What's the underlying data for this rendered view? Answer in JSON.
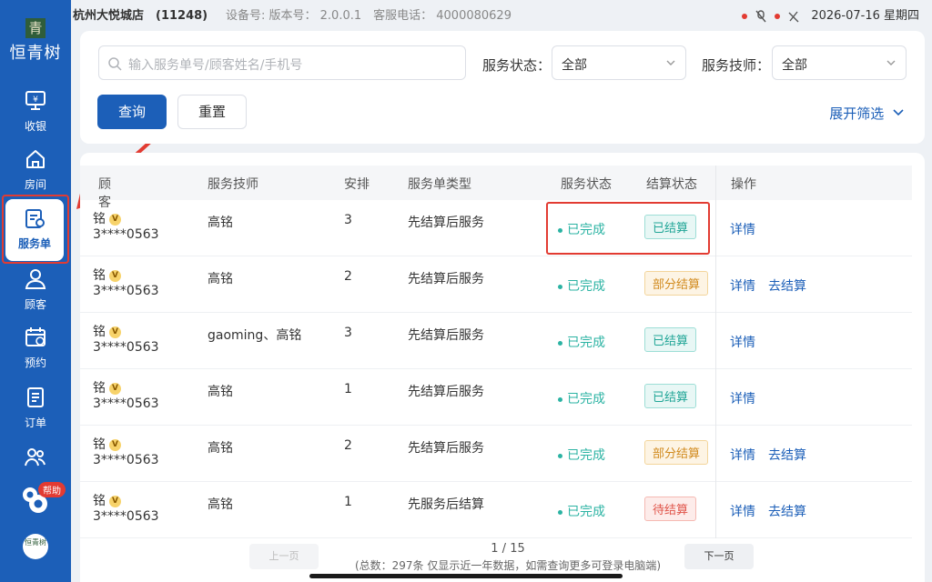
{
  "brand": {
    "logo_char": "青",
    "name": "恒青树",
    "bottom_logo_text": "恒青树"
  },
  "statusbar": {
    "store": "杭州大悦城店　(11248)",
    "meta": "设备号: 版本号： 2.0.0.1　客服电话： 4000080629",
    "datetime": "2026-07-16 星期四"
  },
  "sidebar": {
    "items": [
      {
        "label": "收银",
        "icon": "cashier-icon"
      },
      {
        "label": "房间",
        "icon": "home-icon"
      },
      {
        "label": "服务单",
        "icon": "service-order-icon",
        "active": true
      },
      {
        "label": "顾客",
        "icon": "customer-icon"
      },
      {
        "label": "预约",
        "icon": "calendar-icon"
      },
      {
        "label": "订单",
        "icon": "order-icon"
      },
      {
        "label": "",
        "icon": "staff-icon"
      }
    ],
    "help_label": "帮助"
  },
  "filters": {
    "search_placeholder": "输入服务单号/顾客姓名/手机号",
    "service_status_label": "服务状态：",
    "service_status_value": "全部",
    "technician_label": "服务技师：",
    "technician_value": "全部",
    "query_button": "查询",
    "reset_button": "重置",
    "expand_label": "展开筛选"
  },
  "table": {
    "headers": [
      "顾客",
      "服务技师",
      "安排",
      "服务单类型",
      "服务状态",
      "结算状态",
      "操作"
    ],
    "rows": [
      {
        "name": "铭",
        "phone": "3****0563",
        "tech": "高铭",
        "arrange": "3",
        "type": "先结算后服务",
        "status": "已完成",
        "settle": "已结算",
        "settle_kind": "done",
        "ops": [
          "详情"
        ]
      },
      {
        "name": "铭",
        "phone": "3****0563",
        "tech": "高铭",
        "arrange": "2",
        "type": "先结算后服务",
        "status": "已完成",
        "settle": "部分结算",
        "settle_kind": "partial",
        "ops": [
          "详情",
          "去结算"
        ]
      },
      {
        "name": "铭",
        "phone": "3****0563",
        "tech": "gaoming、高铭",
        "arrange": "3",
        "type": "先结算后服务",
        "status": "已完成",
        "settle": "已结算",
        "settle_kind": "done",
        "ops": [
          "详情"
        ]
      },
      {
        "name": "铭",
        "phone": "3****0563",
        "tech": "高铭",
        "arrange": "1",
        "type": "先结算后服务",
        "status": "已完成",
        "settle": "已结算",
        "settle_kind": "done",
        "ops": [
          "详情"
        ]
      },
      {
        "name": "铭",
        "phone": "3****0563",
        "tech": "高铭",
        "arrange": "2",
        "type": "先结算后服务",
        "status": "已完成",
        "settle": "部分结算",
        "settle_kind": "partial",
        "ops": [
          "详情",
          "去结算"
        ]
      },
      {
        "name": "铭",
        "phone": "3****0563",
        "tech": "高铭",
        "arrange": "1",
        "type": "先服务后结算",
        "status": "已完成",
        "settle": "待结算",
        "settle_kind": "pending",
        "ops": [
          "详情",
          "去结算"
        ]
      }
    ],
    "vip_badge": "V"
  },
  "pagination": {
    "prev": "上一页",
    "next": "下一页",
    "current": "1",
    "total_pages": "15",
    "note": "(总数：297条 仅显示近一年数据，如需查询更多可登录电脑端)"
  },
  "colors": {
    "primary": "#1c5fb8",
    "success": "#2bb3a3",
    "warning": "#d18a1d",
    "danger": "#e0544a",
    "annotation": "#e23b32"
  }
}
